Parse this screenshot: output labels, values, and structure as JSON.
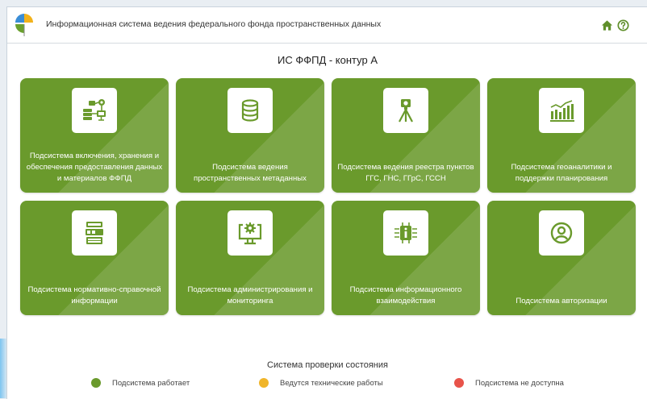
{
  "header": {
    "title": "Информационная система ведения федерального фонда пространственных данных",
    "home_icon": "home-icon",
    "help_icon": "help-icon"
  },
  "main": {
    "title": "ИС ФФПД - контур А"
  },
  "tiles": [
    {
      "label": "Подсистема включения, хранения и обеспечения предоставления данных и материалов ФФПД",
      "icon": "server-network-icon"
    },
    {
      "label": "Подсистема ведения пространственных метаданных",
      "icon": "database-icon"
    },
    {
      "label": "Подсистема ведения реестра пунктов ГГС, ГНС, ГГрС, ГССН",
      "icon": "survey-tripod-icon"
    },
    {
      "label": "Подсистема геоаналитики и поддержки планирования",
      "icon": "bar-chart-icon"
    },
    {
      "label": "Подсистема нормативно-справочной информации",
      "icon": "books-icon"
    },
    {
      "label": "Подсистема администрирования и мониторинга",
      "icon": "monitor-settings-icon"
    },
    {
      "label": "Подсистема информационного взаимодействия",
      "icon": "info-exchange-icon"
    },
    {
      "label": "Подсистема авторизации",
      "icon": "user-circle-icon"
    }
  ],
  "status": {
    "title": "Система проверки состояния",
    "items": [
      {
        "label": "Подсистема работает",
        "color": "#6a9a2c"
      },
      {
        "label": "Ведутся технические работы",
        "color": "#f0b52a"
      },
      {
        "label": "Подсистема не доступна",
        "color": "#e8534a"
      }
    ]
  },
  "colors": {
    "tile": "#6a9a2c",
    "accent": "#5f8f2a"
  }
}
